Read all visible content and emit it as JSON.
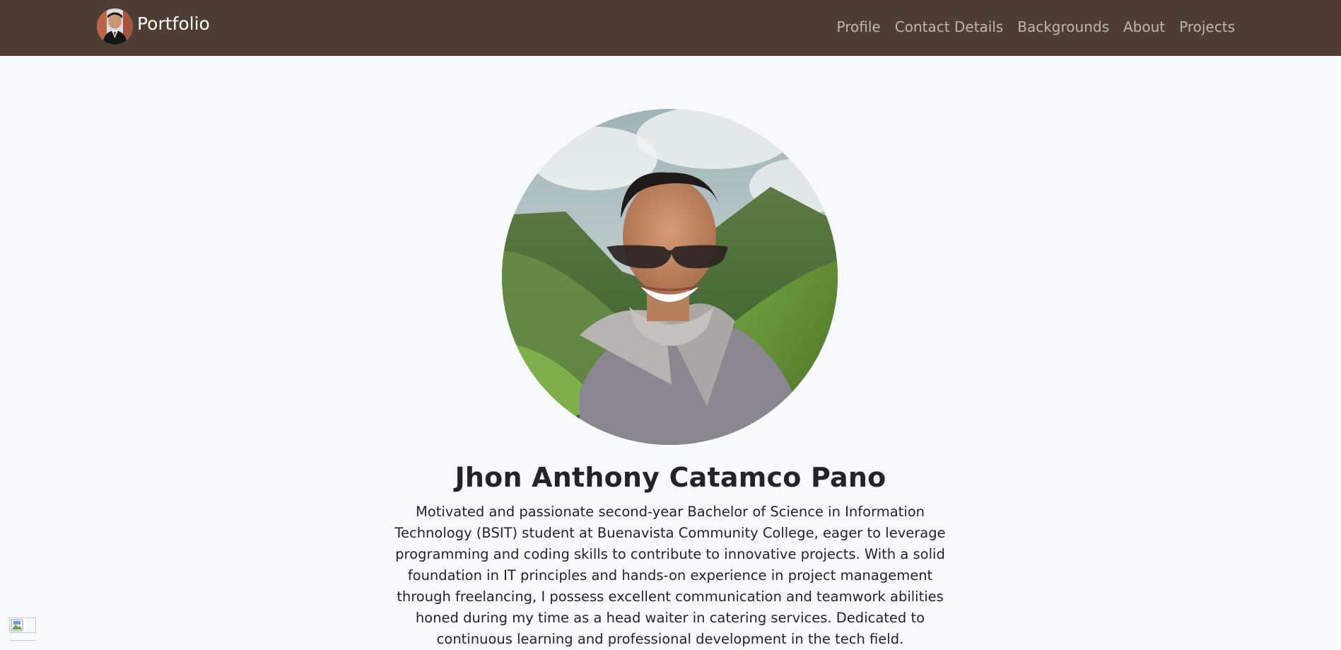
{
  "navbar": {
    "brand_label": "Portfolio",
    "links": [
      {
        "label": "Profile"
      },
      {
        "label": "Contact Details"
      },
      {
        "label": "Backgrounds"
      },
      {
        "label": "About"
      },
      {
        "label": "Projects"
      }
    ]
  },
  "hero": {
    "name": "Jhon Anthony Catamco Pano",
    "bio": "Motivated and passionate second-year Bachelor of Science in Information Technology (BSIT) student at Buenavista Community College, eager to leverage programming and coding skills to contribute to innovative projects. With a solid foundation in IT principles and hands-on experience in project management through freelancing, I possess excellent communication and teamwork abilities honed during my time as a head waiter in catering services. Dedicated to continuous learning and professional development in the tech field."
  },
  "colors": {
    "navbar_bg": "#4e3d33",
    "page_bg": "#f8f9fa",
    "text": "#212529"
  },
  "icons": {
    "broken_image": "broken-image-icon"
  }
}
